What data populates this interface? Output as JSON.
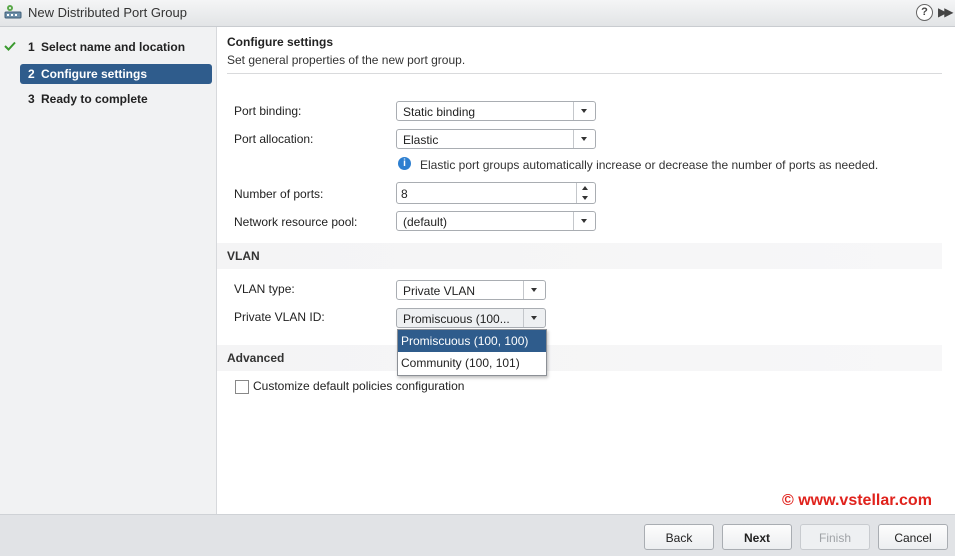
{
  "window": {
    "title": "New Distributed Port Group",
    "help_label": "?",
    "expand_label": "▶▶"
  },
  "sidebar": {
    "steps": [
      {
        "number": "1",
        "label": "Select name and location",
        "completed": true
      },
      {
        "number": "2",
        "label": "Configure settings",
        "active": true
      },
      {
        "number": "3",
        "label": "Ready to complete"
      }
    ]
  },
  "main": {
    "heading": "Configure settings",
    "subheading": "Set general properties of the new port group.",
    "port_binding": {
      "label": "Port binding:",
      "value": "Static binding"
    },
    "port_allocation": {
      "label": "Port allocation:",
      "value": "Elastic"
    },
    "info": "Elastic port groups automatically increase or decrease the number of ports as needed.",
    "number_of_ports": {
      "label": "Number of ports:",
      "value": "8"
    },
    "network_resource_pool": {
      "label": "Network resource pool:",
      "value": "(default)"
    },
    "vlan_section": "VLAN",
    "vlan_type": {
      "label": "VLAN type:",
      "value": "Private VLAN"
    },
    "private_vlan_id": {
      "label": "Private VLAN ID:",
      "value": "Promiscuous (100...",
      "options": [
        "Promiscuous (100, 100)",
        "Community (100, 101)"
      ],
      "selected_index": 0
    },
    "advanced_section": "Advanced",
    "customize_checkbox": {
      "label": "Customize default policies configuration",
      "checked": false
    }
  },
  "watermark": "© www.vstellar.com",
  "footer": {
    "back": "Back",
    "next": "Next",
    "finish": "Finish",
    "cancel": "Cancel"
  },
  "colors": {
    "accent": "#2f5c8c",
    "watermark": "#e0221c",
    "check": "#3a9a2e",
    "info": "#2e7fd0"
  }
}
